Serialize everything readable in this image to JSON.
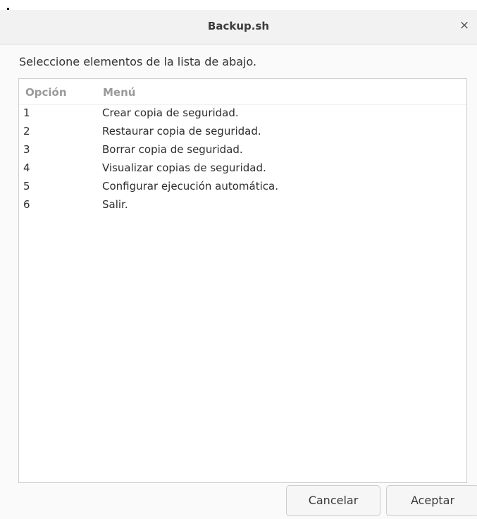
{
  "window": {
    "title": "Backup.sh",
    "close_glyph": "×"
  },
  "prompt": "Seleccione elementos de la lista de abajo.",
  "list": {
    "columns": [
      "Opción",
      "Menú"
    ],
    "rows": [
      {
        "opcion": "1",
        "menu": "Crear copia de seguridad."
      },
      {
        "opcion": "2",
        "menu": "Restaurar copia de seguridad."
      },
      {
        "opcion": "3",
        "menu": "Borrar copia de seguridad."
      },
      {
        "opcion": "4",
        "menu": "Visualizar copias de seguridad."
      },
      {
        "opcion": "5",
        "menu": "Configurar ejecución automática."
      },
      {
        "opcion": "6",
        "menu": "Salir."
      }
    ]
  },
  "buttons": {
    "cancel_label": "Cancelar",
    "ok_label": "Aceptar"
  },
  "icons": {
    "close": "close-icon"
  },
  "colors": {
    "titlebar_bg": "#f2f2f2",
    "dialog_bg": "#fafafa",
    "list_bg": "#ffffff",
    "header_text": "#9a9a9a"
  }
}
